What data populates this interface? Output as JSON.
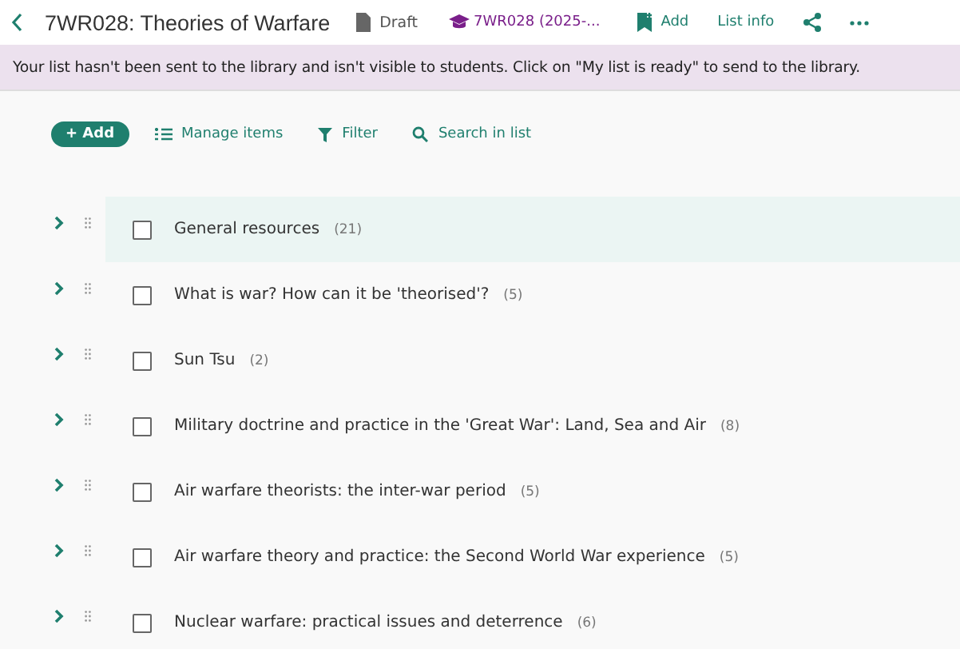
{
  "header": {
    "title": "7WR028: Theories of Warfare",
    "status": "Draft",
    "course": "7WR028 (2025-...",
    "actions": [
      {
        "kind": "add",
        "label": "Add"
      },
      {
        "kind": "text",
        "label": "List info"
      },
      {
        "kind": "share"
      },
      {
        "kind": "more"
      }
    ]
  },
  "banner": "Your list hasn't been sent to the library and isn't visible to students. Click on \"My list is ready\" to send to the library.",
  "toolbar": {
    "add": "+ Add",
    "manage": "Manage items",
    "filter": "Filter",
    "search": "Search in list"
  },
  "sections": [
    {
      "title": "General resources",
      "count": "(21)",
      "selected": true,
      "checked": false
    },
    {
      "title": "What is war? How can it be 'theorised'?",
      "count": "(5)",
      "selected": false,
      "checked": false
    },
    {
      "title": "Sun Tsu",
      "count": "(2)",
      "selected": false,
      "checked": false
    },
    {
      "title": "Military doctrine and practice in the 'Great War': Land, Sea and Air",
      "count": "(8)",
      "selected": false,
      "checked": false
    },
    {
      "title": "Air warfare theorists: the inter-war period",
      "count": "(5)",
      "selected": false,
      "checked": false
    },
    {
      "title": "Air warfare theory and practice: the Second World War experience",
      "count": "(5)",
      "selected": false,
      "checked": false
    },
    {
      "title": "Nuclear warfare: practical issues and deterrence",
      "count": "(6)",
      "selected": false,
      "checked": false
    }
  ]
}
